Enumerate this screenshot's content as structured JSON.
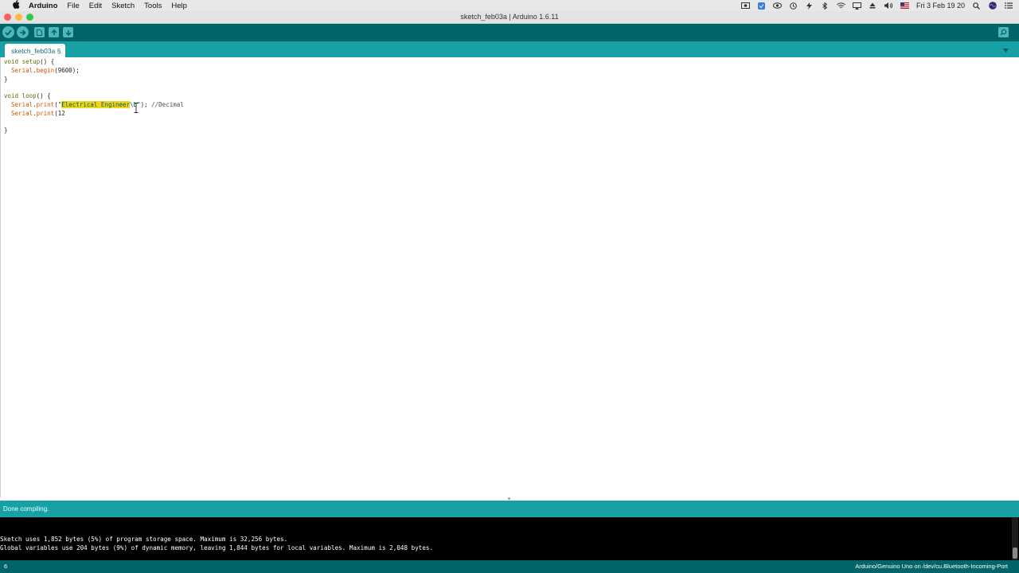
{
  "menubar": {
    "apple_icon": "apple-logo-icon",
    "app_name": "Arduino",
    "menus": [
      "File",
      "Edit",
      "Sketch",
      "Tools",
      "Help"
    ],
    "clock": "Fri 3 Feb  19 20"
  },
  "window": {
    "title": "sketch_feb03a | Arduino 1.6.11",
    "close_color": "#fc605c",
    "minimize_color": "#fdbc40",
    "zoom_color": "#34c84a"
  },
  "toolbar": {
    "verify_icon": "checkmark-icon",
    "upload_icon": "arrow-right-icon",
    "new_icon": "new-file-icon",
    "open_icon": "arrow-up-icon",
    "save_icon": "arrow-down-icon",
    "serial_monitor_icon": "magnifier-icon"
  },
  "tabs": [
    {
      "label": "sketch_feb03a §",
      "active": true
    }
  ],
  "editor": {
    "lines": {
      "l1a": "void",
      "l1b": " setup",
      "l1c": "() {",
      "l2a": "  Serial",
      "l2b": ".",
      "l2c": "begin",
      "l2d": "(9600);",
      "l3": "}",
      "l5a": "void",
      "l5b": " loop",
      "l5c": "() {",
      "l6a": "  Serial",
      "l6b": ".",
      "l6c": "print",
      "l6d": "(",
      "l6e": "\"",
      "l6f": "Electrical Engineer",
      "l6g": "\\b\"",
      "l6h": "); ",
      "l6i": "//Decimal",
      "l7a": "  Serial",
      "l7b": ".",
      "l7c": "print",
      "l7d": "(12",
      "l9": "}"
    }
  },
  "status": {
    "message": "Done compiling."
  },
  "console": {
    "line1": "Sketch uses 1,852 bytes (5%) of program storage space. Maximum is 32,256 bytes.",
    "line2": "Global variables use 204 bytes (9%) of dynamic memory, leaving 1,844 bytes for local variables. Maximum is 2,048 bytes."
  },
  "footer": {
    "line_number": "6",
    "board": "Arduino/Genuino Uno on /dev/cu.Bluetooth-Incoming-Port"
  },
  "colors": {
    "toolbar": "#006468",
    "tabstrip": "#17a1a5",
    "button": "#4db7bb",
    "highlight": "#f2d516"
  }
}
